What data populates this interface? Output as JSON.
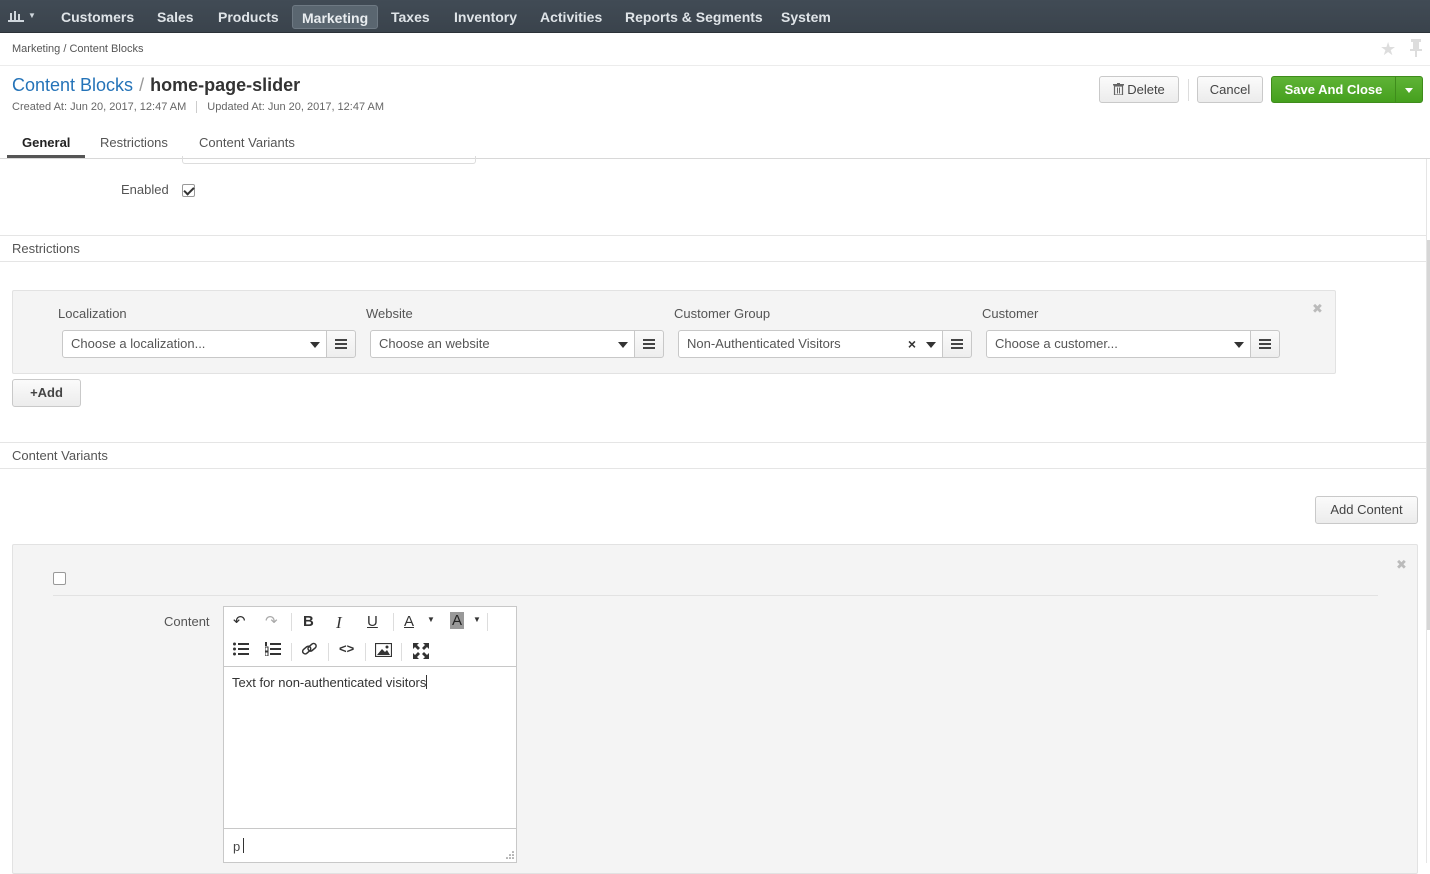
{
  "nav": {
    "items": [
      "Customers",
      "Sales",
      "Products",
      "Marketing",
      "Taxes",
      "Inventory",
      "Activities",
      "Reports & Segments",
      "System"
    ],
    "active": "Marketing"
  },
  "breadcrumb": "Marketing / Content Blocks",
  "header": {
    "parent": "Content Blocks",
    "separator": "/",
    "title": "home-page-slider",
    "created": "Created At: Jun 20, 2017, 12:47 AM",
    "updated": "Updated At: Jun 20, 2017, 12:47 AM"
  },
  "actions": {
    "delete": "Delete",
    "cancel": "Cancel",
    "save": "Save And Close"
  },
  "tabs": [
    "General",
    "Restrictions",
    "Content Variants"
  ],
  "general": {
    "enabled_label": "Enabled",
    "enabled": true
  },
  "restrictions": {
    "heading": "Restrictions",
    "fields": [
      {
        "label": "Localization",
        "value": "Choose a localization..."
      },
      {
        "label": "Website",
        "value": "Choose an website"
      },
      {
        "label": "Customer Group",
        "value": "Non-Authenticated Visitors"
      },
      {
        "label": "Customer",
        "value": "Choose a customer..."
      }
    ],
    "add_label": "Add"
  },
  "variants": {
    "heading": "Content Variants",
    "add_content": "Add Content",
    "content_label": "Content",
    "content_text": "Text for non-authenticated visitors",
    "status_path": "p"
  },
  "colors": {
    "nav_bg": "#3e4750",
    "link": "#2473b8",
    "save_green": "#4ea626"
  }
}
